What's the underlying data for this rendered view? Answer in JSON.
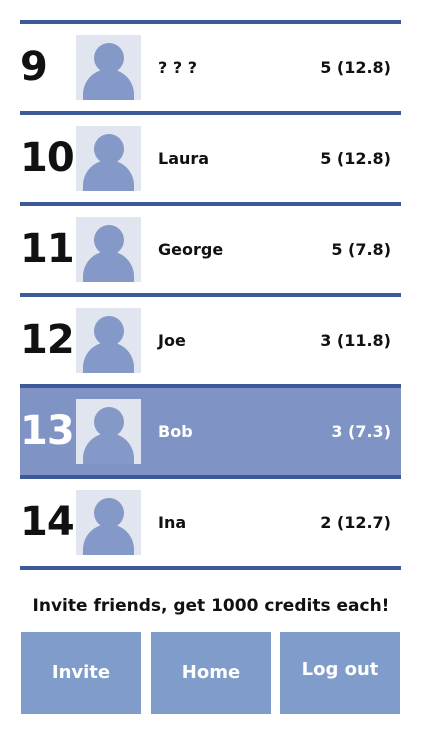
{
  "leaderboard": {
    "rows": [
      {
        "rank": "9",
        "name": "? ? ?",
        "score": "5 (12.8)",
        "highlighted": false
      },
      {
        "rank": "10",
        "name": "Laura",
        "score": "5 (12.8)",
        "highlighted": false
      },
      {
        "rank": "11",
        "name": "George",
        "score": "5 (7.8)",
        "highlighted": false
      },
      {
        "rank": "12",
        "name": "Joe",
        "score": "3 (11.8)",
        "highlighted": false
      },
      {
        "rank": "13",
        "name": "Bob",
        "score": "3 (7.3)",
        "highlighted": true
      },
      {
        "rank": "14",
        "name": "Ina",
        "score": "2 (12.7)",
        "highlighted": false
      }
    ]
  },
  "promo": {
    "text": "Invite friends, get 1000 credits each!"
  },
  "buttons": {
    "invite": "Invite",
    "home": "Home",
    "logout": "Log out"
  },
  "colors": {
    "divider": "#3d5a98",
    "highlight_row": "#7f94c4",
    "button": "#7f9ccb",
    "avatar_bg": "#e1e5ef",
    "avatar_figure": "#8499c8"
  },
  "icons": {
    "avatar": "default-user-avatar-icon"
  }
}
